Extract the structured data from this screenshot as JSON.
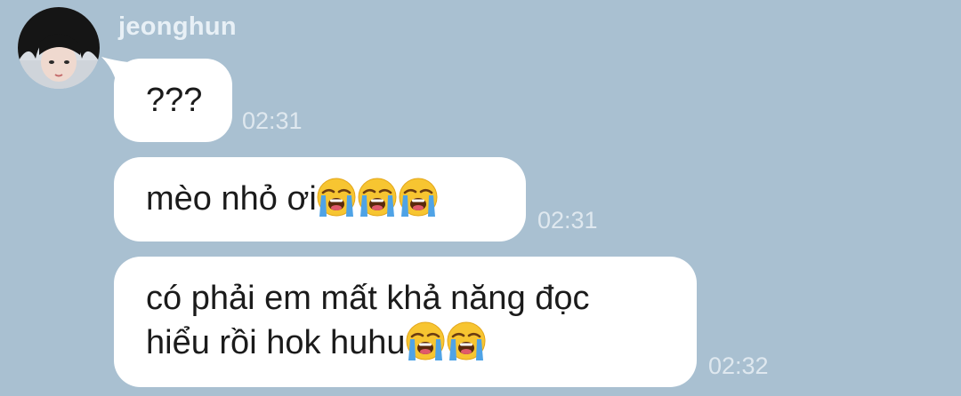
{
  "chat": {
    "sender": "jeonghun",
    "avatar_icon": "user-avatar-photo",
    "messages": [
      {
        "text": "???",
        "emoji": [],
        "time": "02:31"
      },
      {
        "text": "mèo nhỏ ơi",
        "emoji": [
          "loudly-crying-face",
          "loudly-crying-face",
          "loudly-crying-face"
        ],
        "time": "02:31"
      },
      {
        "line1": "có phải em mất khả năng đọc",
        "line2": "hiểu rồi hok huhu",
        "emoji": [
          "loudly-crying-face",
          "loudly-crying-face"
        ],
        "time": "02:32"
      }
    ]
  },
  "colors": {
    "background": "#a9c0d1",
    "bubble": "#ffffff",
    "timestamp": "#dfe8ef",
    "sender_name": "#e8f0f6"
  }
}
